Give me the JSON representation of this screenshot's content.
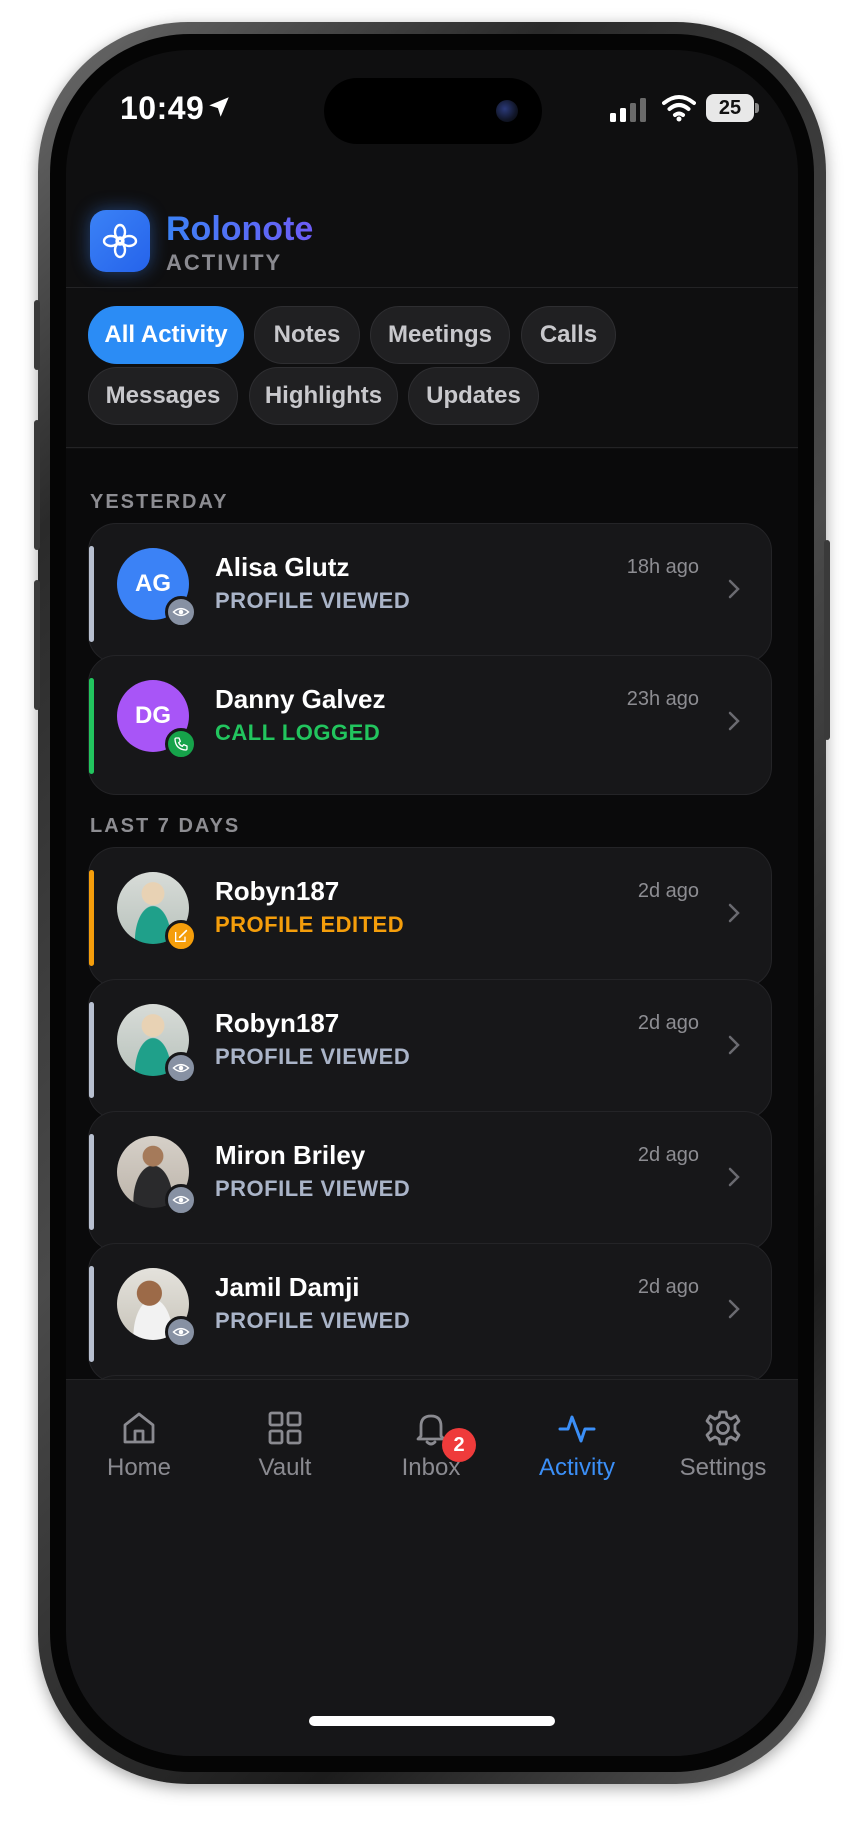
{
  "status_bar": {
    "time": "10:49",
    "battery": "25"
  },
  "app": {
    "name": "Rolonote",
    "section": "ACTIVITY"
  },
  "filters": [
    {
      "label": "All Activity",
      "active": true
    },
    {
      "label": "Notes",
      "active": false
    },
    {
      "label": "Meetings",
      "active": false
    },
    {
      "label": "Calls",
      "active": false
    },
    {
      "label": "Messages",
      "active": false
    },
    {
      "label": "Highlights",
      "active": false
    },
    {
      "label": "Updates",
      "active": false
    }
  ],
  "sections": [
    {
      "label": "YESTERDAY",
      "items": [
        {
          "name": "Alisa Glutz",
          "action": "PROFILE VIEWED",
          "time": "18h ago",
          "initials": "AG",
          "avatar_color": "#3b82f6",
          "accent": "#b8c0d0",
          "badge": "eye-icon"
        },
        {
          "name": "Danny Galvez",
          "action": "CALL LOGGED",
          "time": "23h ago",
          "initials": "DG",
          "avatar_color": "#a855f7",
          "accent": "#22c55e",
          "badge": "phone-icon"
        }
      ]
    },
    {
      "label": "LAST 7 DAYS",
      "items": [
        {
          "name": "Robyn187",
          "action": "PROFILE EDITED",
          "time": "2d ago",
          "initials": "",
          "avatar_color": "#6b7f78",
          "accent": "#f59e0b",
          "badge": "edit-icon"
        },
        {
          "name": "Robyn187",
          "action": "PROFILE VIEWED",
          "time": "2d ago",
          "initials": "",
          "avatar_color": "#6b7f78",
          "accent": "#b8c0d0",
          "badge": "eye-icon"
        },
        {
          "name": "Miron Briley",
          "action": "PROFILE VIEWED",
          "time": "2d ago",
          "initials": "",
          "avatar_color": "#4a4440",
          "accent": "#b8c0d0",
          "badge": "eye-icon"
        },
        {
          "name": "Jamil Damji",
          "action": "PROFILE VIEWED",
          "time": "2d ago",
          "initials": "",
          "avatar_color": "#8a7f72",
          "accent": "#b8c0d0",
          "badge": "eye-icon"
        }
      ]
    }
  ],
  "tabs": [
    {
      "label": "Home",
      "icon": "home-icon",
      "active": false
    },
    {
      "label": "Vault",
      "icon": "grid-icon",
      "active": false
    },
    {
      "label": "Inbox",
      "icon": "bell-icon",
      "active": false,
      "badge": "2"
    },
    {
      "label": "Activity",
      "icon": "activity-icon",
      "active": true
    },
    {
      "label": "Settings",
      "icon": "gear-icon",
      "active": false
    }
  ],
  "colors": {
    "accent": "#2b8cf5",
    "background": "#0f0f10",
    "card": "#171719"
  }
}
